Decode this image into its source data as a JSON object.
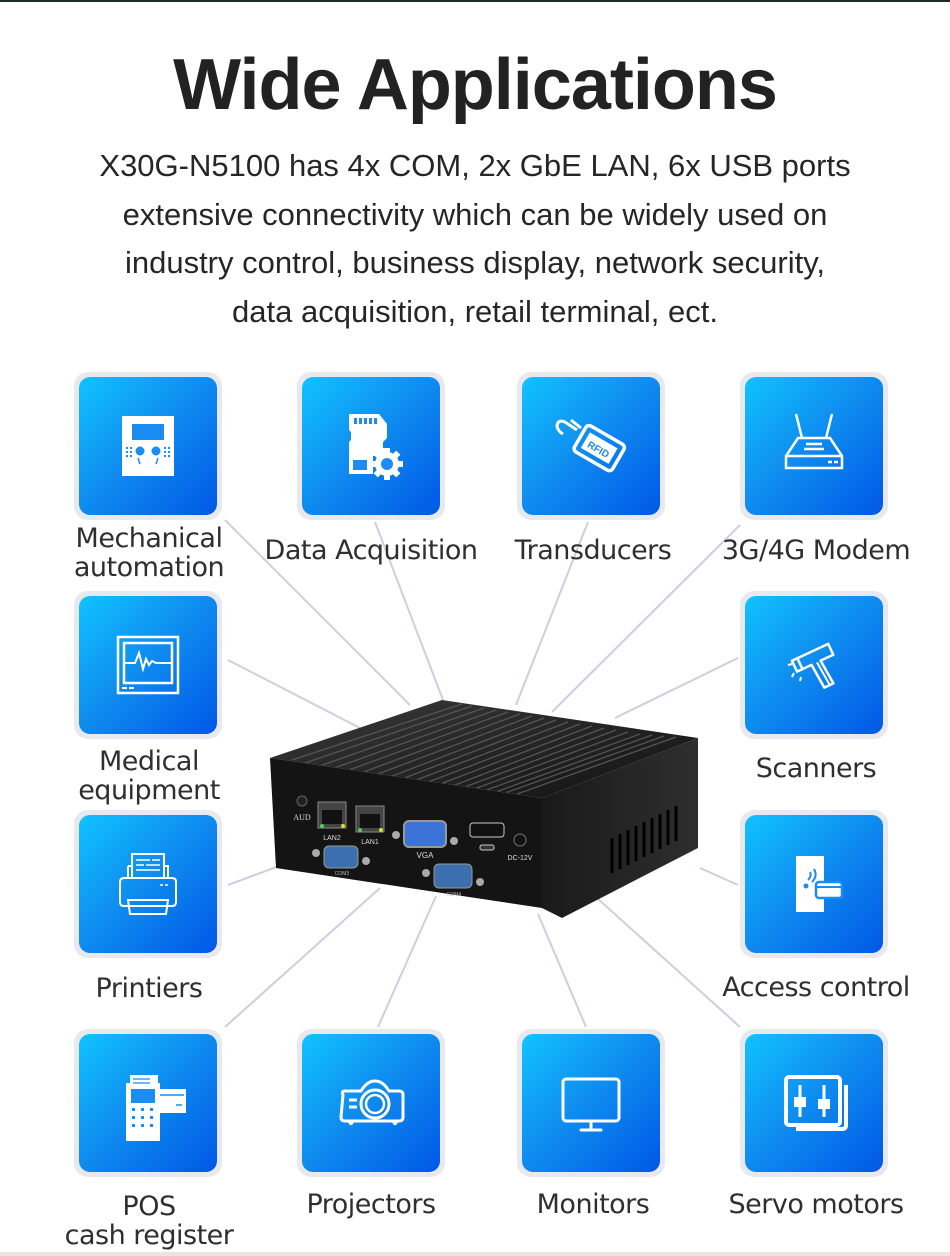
{
  "header": {
    "title": "Wide Applications",
    "description_lines": [
      "X30G-N5100 has 4x COM, 2x GbE LAN, 6x USB ports",
      "extensive connectivity which can be widely used on",
      "industry control, business display, network security,",
      "data acquisition, retail terminal, ect."
    ]
  },
  "applications": [
    {
      "icon": "control-panel-icon",
      "label_lines": [
        "Mechanical",
        "automation"
      ]
    },
    {
      "icon": "sd-card-gear-icon",
      "label_lines": [
        "Data Acquisition"
      ]
    },
    {
      "icon": "rfid-tag-icon",
      "label_lines": [
        "Transducers"
      ]
    },
    {
      "icon": "router-icon",
      "label_lines": [
        "3G/4G Modem"
      ]
    },
    {
      "icon": "heart-monitor-icon",
      "label_lines": [
        "Medical",
        "equipment"
      ]
    },
    {
      "icon": "barcode-scanner-icon",
      "label_lines": [
        "Scanners"
      ]
    },
    {
      "icon": "printer-icon",
      "label_lines": [
        "Printiers"
      ]
    },
    {
      "icon": "access-card-icon",
      "label_lines": [
        "Access control"
      ]
    },
    {
      "icon": "pos-terminal-icon",
      "label_lines": [
        "POS",
        "cash register"
      ]
    },
    {
      "icon": "projector-icon",
      "label_lines": [
        "Projectors"
      ]
    },
    {
      "icon": "monitor-icon",
      "label_lines": [
        "Monitors"
      ]
    },
    {
      "icon": "servo-controller-icon",
      "label_lines": [
        "Servo motors"
      ]
    }
  ],
  "device": {
    "ports": [
      "AUD",
      "LAN2",
      "LAN1",
      "VGA",
      "DC-12V",
      "COM3",
      "COM4"
    ]
  },
  "colors": {
    "card_gradient_start": "#10c3ff",
    "card_gradient_end": "#0057e6",
    "card_border": "#e7e9ee",
    "connector_line": "#c9d0e0",
    "device_body": "#1a1a1a",
    "text": "#2b2b2b"
  }
}
